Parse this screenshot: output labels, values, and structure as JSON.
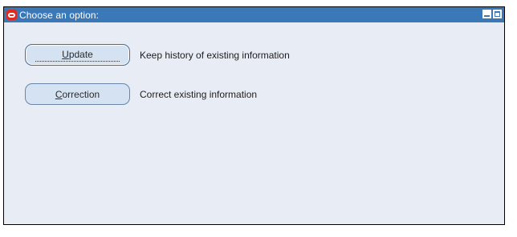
{
  "window": {
    "title": "Choose an option:",
    "app_icon": "oracle-o-icon",
    "controls": [
      "minimize-icon",
      "maximize-icon"
    ]
  },
  "options": [
    {
      "label": "Update",
      "mnemonic": "U",
      "label_rest": "pdate",
      "description": "Keep history of existing information",
      "focused": true
    },
    {
      "label": "Correction",
      "mnemonic": "C",
      "label_rest": "orrection",
      "description": "Correct existing information",
      "focused": false
    }
  ],
  "colors": {
    "title_bar": "#3a78b7",
    "window_bg": "#e8ecf4",
    "button_bg": "#d4e2f2",
    "app_icon": "#e22a1f"
  }
}
